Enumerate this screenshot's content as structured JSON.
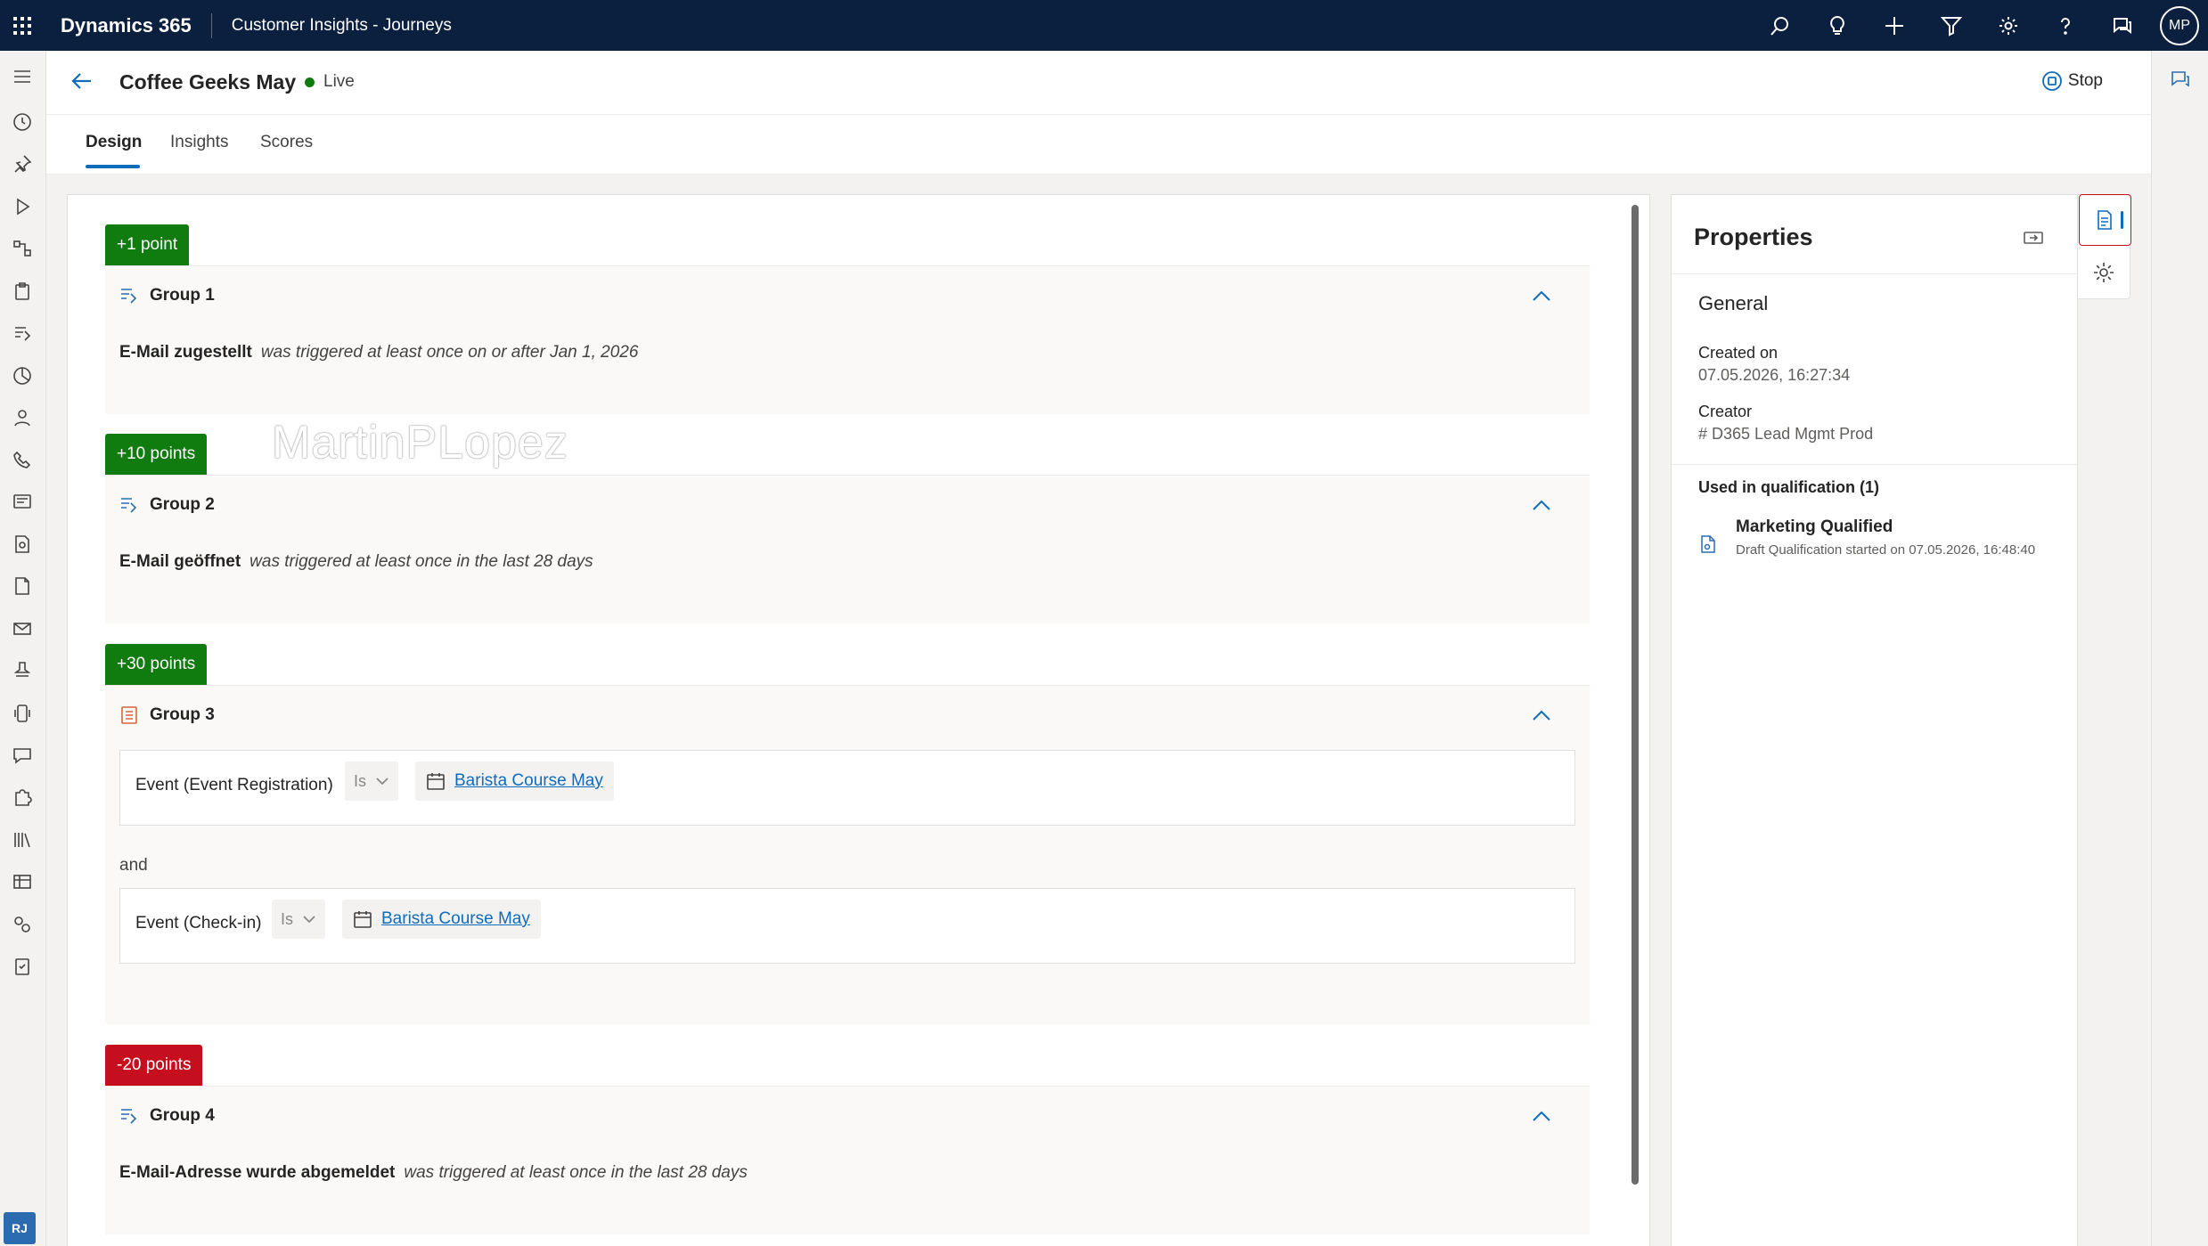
{
  "topbar": {
    "app_name": "Dynamics 365",
    "area_name": "Customer Insights - Journeys",
    "icons": [
      "search-icon",
      "lightbulb-icon",
      "plus-icon",
      "filter-icon",
      "settings-icon",
      "help-icon",
      "chat-icon"
    ],
    "user_initials": "MP"
  },
  "header": {
    "title": "Coffee Geeks May",
    "status": "Live",
    "stop_label": "Stop"
  },
  "tabs": [
    {
      "label": "Design",
      "active": true
    },
    {
      "label": "Insights",
      "active": false
    },
    {
      "label": "Scores",
      "active": false
    }
  ],
  "groups": [
    {
      "points": "+1 point",
      "name": "Group 1",
      "event": "E-Mail zugestellt",
      "trigger": "was triggered at least once on or after Jan 1, 2026"
    },
    {
      "points": "+10 points",
      "name": "Group 2",
      "event": "E-Mail geöffnet",
      "trigger": "was triggered at least once in the last 28 days"
    },
    {
      "points": "+30 points",
      "name": "Group 3",
      "conditions": [
        {
          "label": "Event (Event Registration)",
          "operator": "Is",
          "value": "Barista Course May"
        },
        {
          "label": "Event (Check-in)",
          "operator": "Is",
          "value": "Barista Course May"
        }
      ],
      "connector": "and"
    },
    {
      "points": "-20 points",
      "name": "Group 4",
      "event": "E-Mail-Adresse wurde abgemeldet",
      "trigger": "was triggered at least once in the last 28 days"
    }
  ],
  "watermark": "MartinPLopez",
  "properties": {
    "title": "Properties",
    "section": "General",
    "created_on_label": "Created on",
    "created_on_value": "07.05.2026, 16:27:34",
    "creator_label": "Creator",
    "creator_value": "# D365 Lead Mgmt Prod",
    "used_in_title": "Used in qualification (1)",
    "qualification_name": "Marketing Qualified",
    "qualification_sub": "Draft Qualification started on 07.05.2026, 16:48:40"
  },
  "left_rail_user": "RJ",
  "colors": {
    "topbar": "#0b1f3f",
    "positive_badge": "#107c10",
    "negative_badge": "#c50f1f",
    "accent": "#0f6cbd"
  }
}
